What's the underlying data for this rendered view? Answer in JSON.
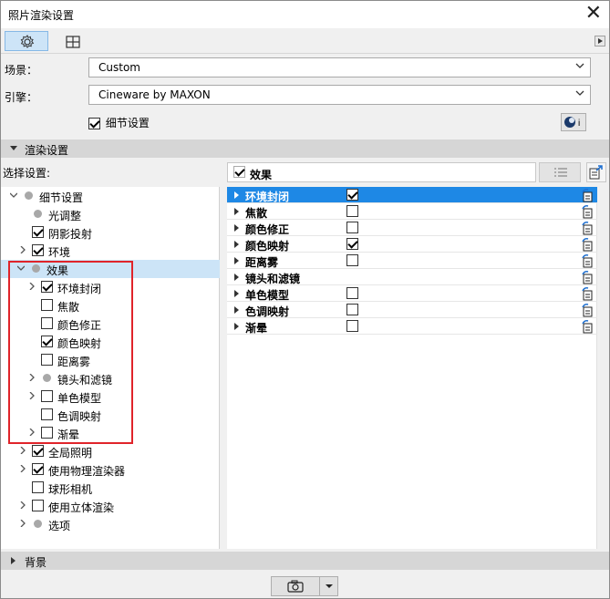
{
  "window": {
    "title": "照片渲染设置",
    "close_glyph": "✕"
  },
  "toolbar": {
    "settings_icon": "gear-icon",
    "layout_icon": "grid-icon"
  },
  "scene": {
    "label": "场景：",
    "value": "Custom"
  },
  "engine": {
    "label": "引擎：",
    "value": "Cineware by MAXON"
  },
  "detail_settings": {
    "label": "细节设置",
    "checked": true
  },
  "render_settings_section": {
    "label": "渲染设置"
  },
  "select_settings_label": "选择设置:",
  "tree": [
    {
      "label": "细节设置",
      "marker": "dot",
      "expander": "expanded"
    },
    {
      "label": "光调整",
      "marker": "dot",
      "expander": "none"
    },
    {
      "label": "阴影投射",
      "marker": "checkbox",
      "checked": true,
      "expander": "none"
    },
    {
      "label": "环境",
      "marker": "checkbox",
      "checked": true,
      "expander": "collapsed"
    },
    {
      "label": "效果",
      "marker": "dot",
      "expander": "expanded"
    },
    {
      "label": "环境封闭",
      "marker": "checkbox",
      "checked": true,
      "expander": "collapsed"
    },
    {
      "label": "焦散",
      "marker": "checkbox",
      "checked": false,
      "expander": "none"
    },
    {
      "label": "颜色修正",
      "marker": "checkbox",
      "checked": false,
      "expander": "none"
    },
    {
      "label": "颜色映射",
      "marker": "checkbox",
      "checked": true,
      "expander": "none"
    },
    {
      "label": "距离雾",
      "marker": "checkbox",
      "checked": false,
      "expander": "none"
    },
    {
      "label": "镜头和滤镜",
      "marker": "dot",
      "expander": "collapsed"
    },
    {
      "label": "单色模型",
      "marker": "checkbox",
      "checked": false,
      "expander": "collapsed"
    },
    {
      "label": "色调映射",
      "marker": "checkbox",
      "checked": false,
      "expander": "none"
    },
    {
      "label": "渐晕",
      "marker": "checkbox",
      "checked": false,
      "expander": "collapsed"
    },
    {
      "label": "全局照明",
      "marker": "checkbox",
      "checked": true,
      "expander": "collapsed"
    },
    {
      "label": "使用物理渲染器",
      "marker": "checkbox",
      "checked": true,
      "expander": "collapsed"
    },
    {
      "label": "球形相机",
      "marker": "checkbox",
      "checked": false,
      "expander": "none"
    },
    {
      "label": "使用立体渲染",
      "marker": "checkbox",
      "checked": false,
      "expander": "collapsed"
    },
    {
      "label": "选项",
      "marker": "dot",
      "expander": "collapsed"
    }
  ],
  "effects_header": {
    "label": "效果"
  },
  "effects": [
    {
      "label": "环境封闭",
      "has_checkbox": true,
      "checked": true
    },
    {
      "label": "焦散",
      "has_checkbox": true,
      "checked": false
    },
    {
      "label": "颜色修正",
      "has_checkbox": true,
      "checked": false
    },
    {
      "label": "颜色映射",
      "has_checkbox": true,
      "checked": true
    },
    {
      "label": "距离雾",
      "has_checkbox": true,
      "checked": false
    },
    {
      "label": "镜头和滤镜",
      "has_checkbox": false,
      "checked": false
    },
    {
      "label": "单色模型",
      "has_checkbox": true,
      "checked": false
    },
    {
      "label": "色调映射",
      "has_checkbox": true,
      "checked": false
    },
    {
      "label": "渐晕",
      "has_checkbox": true,
      "checked": false
    }
  ],
  "background_section": {
    "label": "背景"
  },
  "footer": {
    "camera_icon": "camera-icon"
  },
  "colors": {
    "selection": "#1e88e5",
    "tree_selection": "#cce4f7",
    "highlight_box": "#e0242a"
  }
}
